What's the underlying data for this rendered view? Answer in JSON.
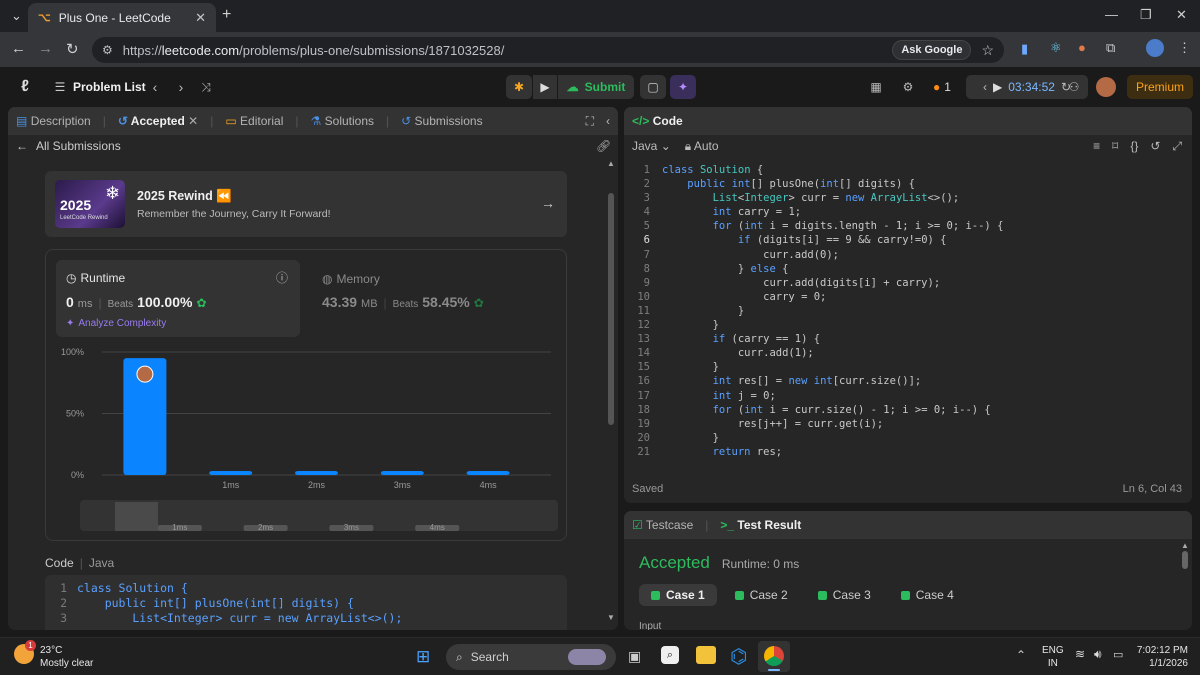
{
  "browser": {
    "tab_title": "Plus One - LeetCode",
    "url_prefix": "https://",
    "url_host": "leetcode.com",
    "url_path": "/problems/plus-one/submissions/1871032528/",
    "ask_google": "Ask Google"
  },
  "header": {
    "problem_list": "Problem List",
    "submit": "Submit",
    "streak": "1",
    "timer": "03:34:52",
    "premium": "Premium"
  },
  "left_tabs": [
    "Description",
    "Accepted",
    "Editorial",
    "Solutions",
    "Submissions"
  ],
  "all_submissions": "All Submissions",
  "rewind": {
    "img_year": "2025",
    "img_sub": "LeetCode Rewind",
    "title": "2025 Rewind",
    "subtitle": "Remember the Journey, Carry It Forward!"
  },
  "runtime": {
    "label": "Runtime",
    "value": "0",
    "unit": "ms",
    "beats_label": "Beats",
    "beats": "100.00%",
    "analyze": "Analyze Complexity"
  },
  "memory": {
    "label": "Memory",
    "value": "43.39",
    "unit": "MB",
    "beats_label": "Beats",
    "beats": "58.45%"
  },
  "chart_data": {
    "type": "bar",
    "categories": [
      "0ms",
      "1ms",
      "2ms",
      "3ms",
      "4ms"
    ],
    "tick_labels": [
      "",
      "1ms",
      "2ms",
      "3ms",
      "4ms"
    ],
    "values": [
      95,
      1,
      1,
      1,
      1
    ],
    "y_ticks": [
      "100%",
      "50%",
      "0%"
    ],
    "ylim": [
      0,
      100
    ],
    "highlight_index": 0,
    "bar_color": "#0a84ff",
    "scrubber_labels": [
      "1ms",
      "2ms",
      "3ms",
      "4ms"
    ]
  },
  "code_section": {
    "label": "Code",
    "lang": "Java"
  },
  "code_preview": [
    "class Solution {",
    "    public int[] plusOne(int[] digits) {",
    "        List<Integer> curr = new ArrayList<>();"
  ],
  "editor": {
    "tab": "Code",
    "language": "Java",
    "mode": "Auto",
    "saved": "Saved",
    "cursor": "Ln 6, Col 43",
    "current_line": 6,
    "lines": [
      "class Solution {",
      "    public int[] plusOne(int[] digits) {",
      "        List<Integer> curr = new ArrayList<>();",
      "        int carry = 1;",
      "        for (int i = digits.length - 1; i >= 0; i--) {",
      "            if (digits[i] == 9 && carry!=0) {",
      "                curr.add(0);",
      "            } else {",
      "                curr.add(digits[i] + carry);",
      "                carry = 0;",
      "            }",
      "        }",
      "        if (carry == 1) {",
      "            curr.add(1);",
      "        }",
      "        int res[] = new int[curr.size()];",
      "        int j = 0;",
      "        for (int i = curr.size() - 1; i >= 0; i--) {",
      "            res[j++] = curr.get(i);",
      "        }",
      "        return res;"
    ]
  },
  "result": {
    "tab_testcase": "Testcase",
    "tab_result": "Test Result",
    "status": "Accepted",
    "runtime": "Runtime: 0 ms",
    "cases": [
      "Case 1",
      "Case 2",
      "Case 3",
      "Case 4"
    ],
    "input_label": "Input"
  },
  "taskbar": {
    "temp": "23°C",
    "weather": "Mostly clear",
    "weather_badge": "1",
    "search": "Search",
    "lang1": "ENG",
    "lang2": "IN",
    "time": "7:02:12 PM",
    "date": "1/1/2026"
  },
  "colors": {
    "accent_green": "#2cbb5d",
    "accent_blue": "#0a84ff",
    "premium": "#ffa116"
  }
}
